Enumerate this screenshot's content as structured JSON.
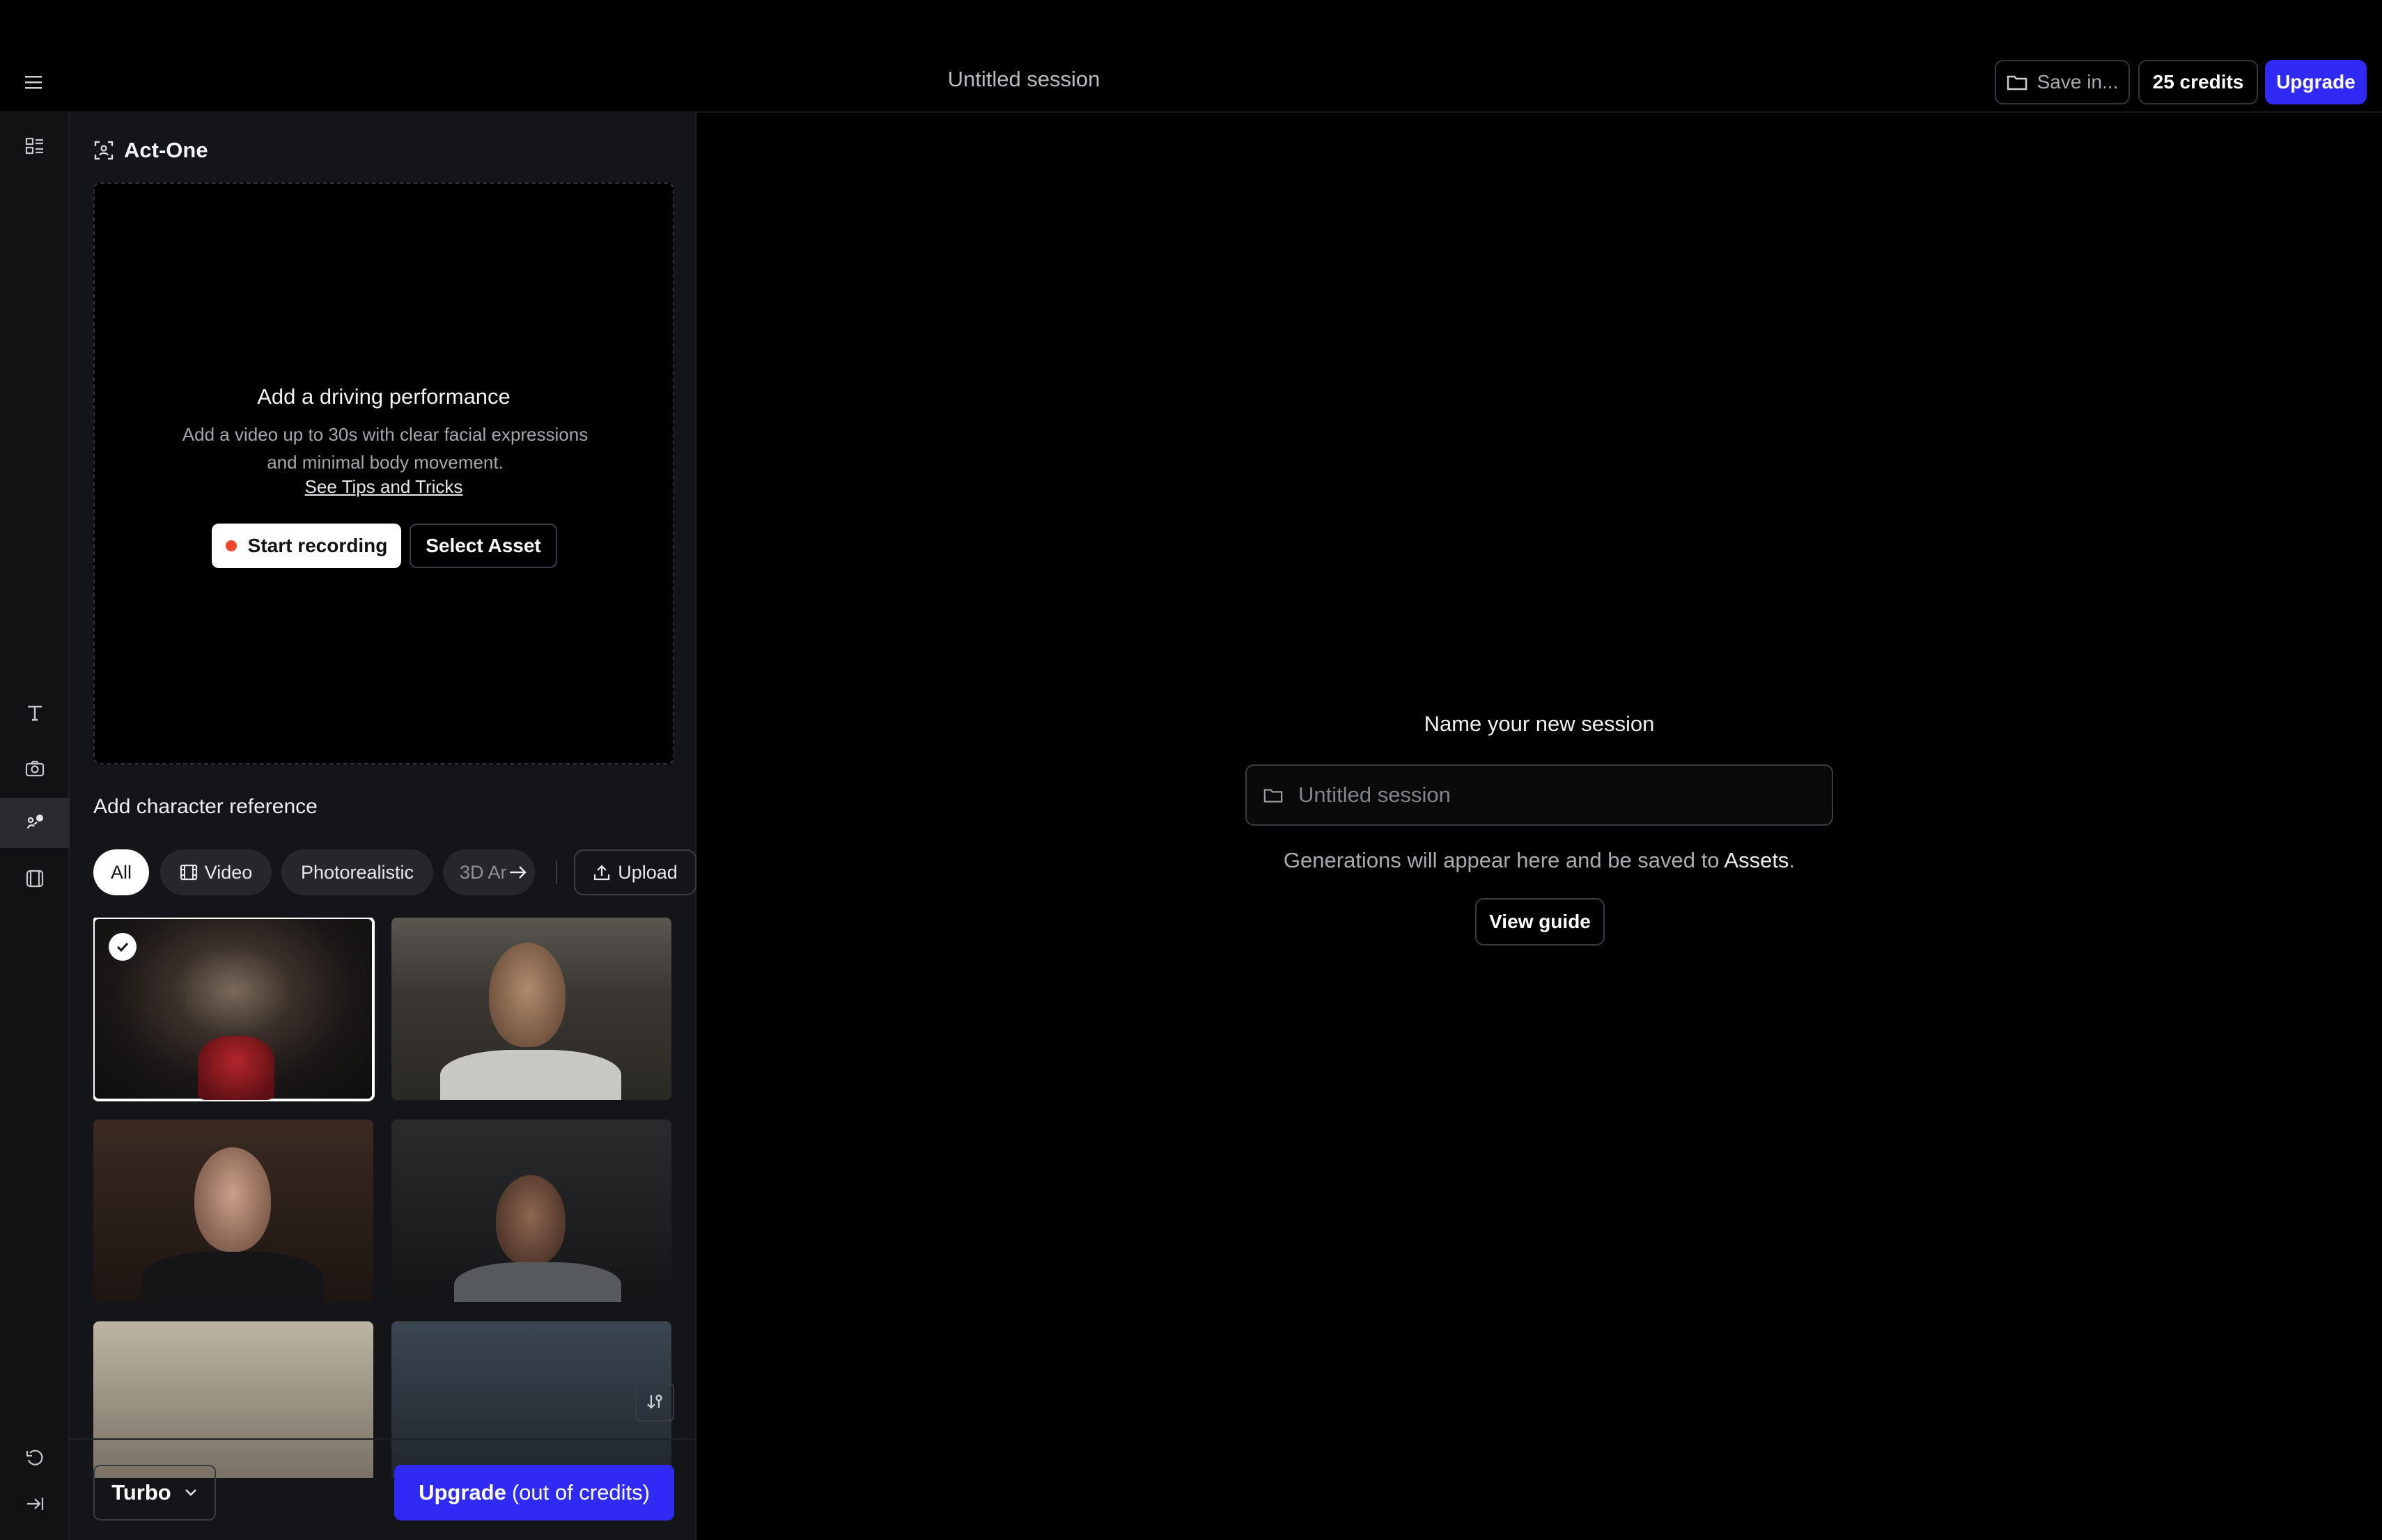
{
  "header": {
    "session_title": "Untitled session",
    "save_label": "Save in...",
    "credits_label": "25 credits",
    "upgrade_label": "Upgrade"
  },
  "panel": {
    "title": "Act-One",
    "drop_zone": {
      "title": "Add a driving performance",
      "description": "Add a video up to 30s with clear facial expressions and minimal body movement.",
      "tips_link": "See Tips and Tricks",
      "record_label": "Start recording",
      "select_label": "Select Asset"
    },
    "character_reference_title": "Add character reference",
    "filters": {
      "all": "All",
      "video": "Video",
      "photorealistic": "Photorealistic",
      "three_d": "3D Ar",
      "upload": "Upload"
    },
    "footer": {
      "model_label": "Turbo",
      "upgrade_strong": "Upgrade",
      "upgrade_note": "(out of credits)"
    }
  },
  "main": {
    "name_label": "Name your new session",
    "input_placeholder": "Untitled session",
    "note_prefix": "Generations will appear here and be saved to ",
    "note_link": "Assets",
    "note_suffix": ".",
    "guide_label": "View guide"
  },
  "colors": {
    "accent": "#2f2bf5",
    "record_dot": "#f2452a"
  }
}
